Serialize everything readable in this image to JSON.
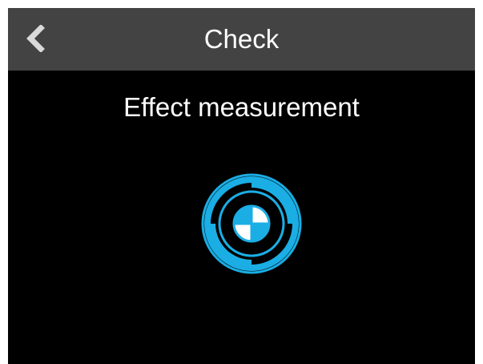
{
  "header": {
    "title": "Check",
    "back_icon": "chevron-left-icon"
  },
  "main": {
    "heading": "Effect measurement",
    "indicator_icon": "measurement-target-icon"
  },
  "colors": {
    "background": "#000000",
    "header_background": "#434343",
    "text": "#FFFFFF",
    "accent": "#1AAEE5"
  }
}
